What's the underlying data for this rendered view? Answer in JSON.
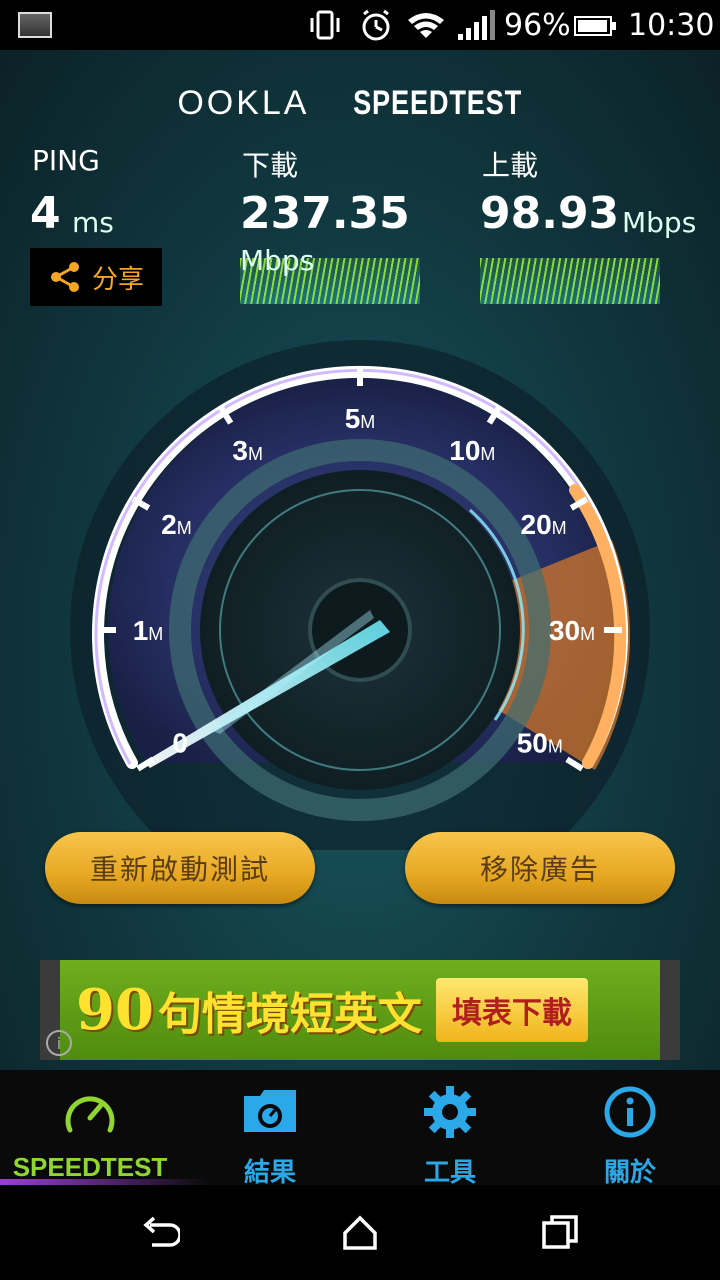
{
  "status_bar": {
    "battery_percent_text": "96%",
    "battery_level": 0.96,
    "time": "10:30"
  },
  "header": {
    "brand_ookla": "OOKLA",
    "brand_speedtest": "SPEEDTEST"
  },
  "results": {
    "ping": {
      "label": "PING",
      "value": "4",
      "unit": "ms"
    },
    "download": {
      "label": "下載",
      "value": "237.35",
      "unit": "Mbps"
    },
    "upload": {
      "label": "上載",
      "value": "98.93",
      "unit": "Mbps"
    },
    "share_label": "分享"
  },
  "gauge": {
    "tick_labels": [
      {
        "num": "0",
        "unit": ""
      },
      {
        "num": "1",
        "unit": "M"
      },
      {
        "num": "2",
        "unit": "M"
      },
      {
        "num": "3",
        "unit": "M"
      },
      {
        "num": "5",
        "unit": "M"
      },
      {
        "num": "10",
        "unit": "M"
      },
      {
        "num": "20",
        "unit": "M"
      },
      {
        "num": "30",
        "unit": "M"
      },
      {
        "num": "50",
        "unit": "M"
      }
    ]
  },
  "buttons": {
    "restart_label": "重新啟動測試",
    "remove_ads_label": "移除廣告"
  },
  "ad": {
    "number": "90",
    "text": "句情境短英文",
    "cta": "填表下載"
  },
  "tabs": [
    {
      "label": "SPEEDTEST",
      "icon": "gauge-icon",
      "active": true
    },
    {
      "label": "結果",
      "icon": "folder-icon",
      "active": false
    },
    {
      "label": "工具",
      "icon": "gear-icon",
      "active": false
    },
    {
      "label": "關於",
      "icon": "info-icon",
      "active": false
    }
  ],
  "colors": {
    "accent_orange": "#f5a623",
    "tab_blue": "#2ba8e8",
    "tab_green": "#8fd631",
    "button_gold": "#e7a823"
  }
}
